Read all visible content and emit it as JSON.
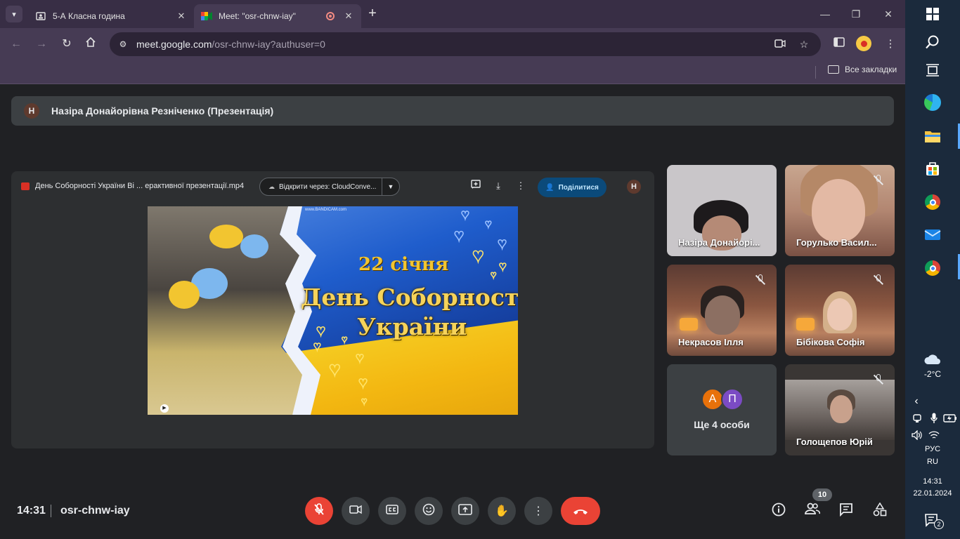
{
  "browser": {
    "tabs": [
      {
        "title": "5-А Класна година",
        "active": false
      },
      {
        "title": "Meet: \"osr-chnw-iay\"",
        "active": true
      }
    ],
    "url_host": "meet.google.com",
    "url_path": "/osr-chnw-iay?authuser=0",
    "bookmarks_label": "Все закладки"
  },
  "meet": {
    "presenter_initial": "Н",
    "presenter_name": "Назіра Донайорівна Резніченко (Презентація)",
    "file_name": "День Соборності України Ві ... ерактивної презентації.mp4",
    "open_with_label": "Відкрити через: CloudConve...",
    "share_label": "Поділитися",
    "owner_initial": "Н",
    "slide": {
      "watermark": "www.BANDICAM.com",
      "date": "22 січня",
      "line1": "День Соборності",
      "line2": "України"
    },
    "participants": [
      {
        "name": "Назіра Донайорі...",
        "muted": false
      },
      {
        "name": "Горулько Васил...",
        "muted": true
      },
      {
        "name": "Некрасов Ілля",
        "muted": true
      },
      {
        "name": "Бібікова Софія",
        "muted": true
      },
      {
        "name": "Голощепов Юрій",
        "muted": true
      }
    ],
    "others": {
      "initials": [
        "А",
        "П"
      ],
      "colors": [
        "#e8710a",
        "#7b4bc4"
      ],
      "label": "Ще 4 особи"
    },
    "time": "14:31",
    "meeting_code": "osr-chnw-iay",
    "people_count": "10"
  },
  "taskbar": {
    "temperature": "-2°C",
    "language": "РУС",
    "language_sub": "RU",
    "time": "14:31",
    "date": "22.01.2024",
    "notifications": "2"
  },
  "colors": {
    "tab_strip": "#382e45",
    "toolbar": "#463b54",
    "meet_bg": "#202124",
    "danger": "#ea4335",
    "share": "#0b4a7a"
  }
}
